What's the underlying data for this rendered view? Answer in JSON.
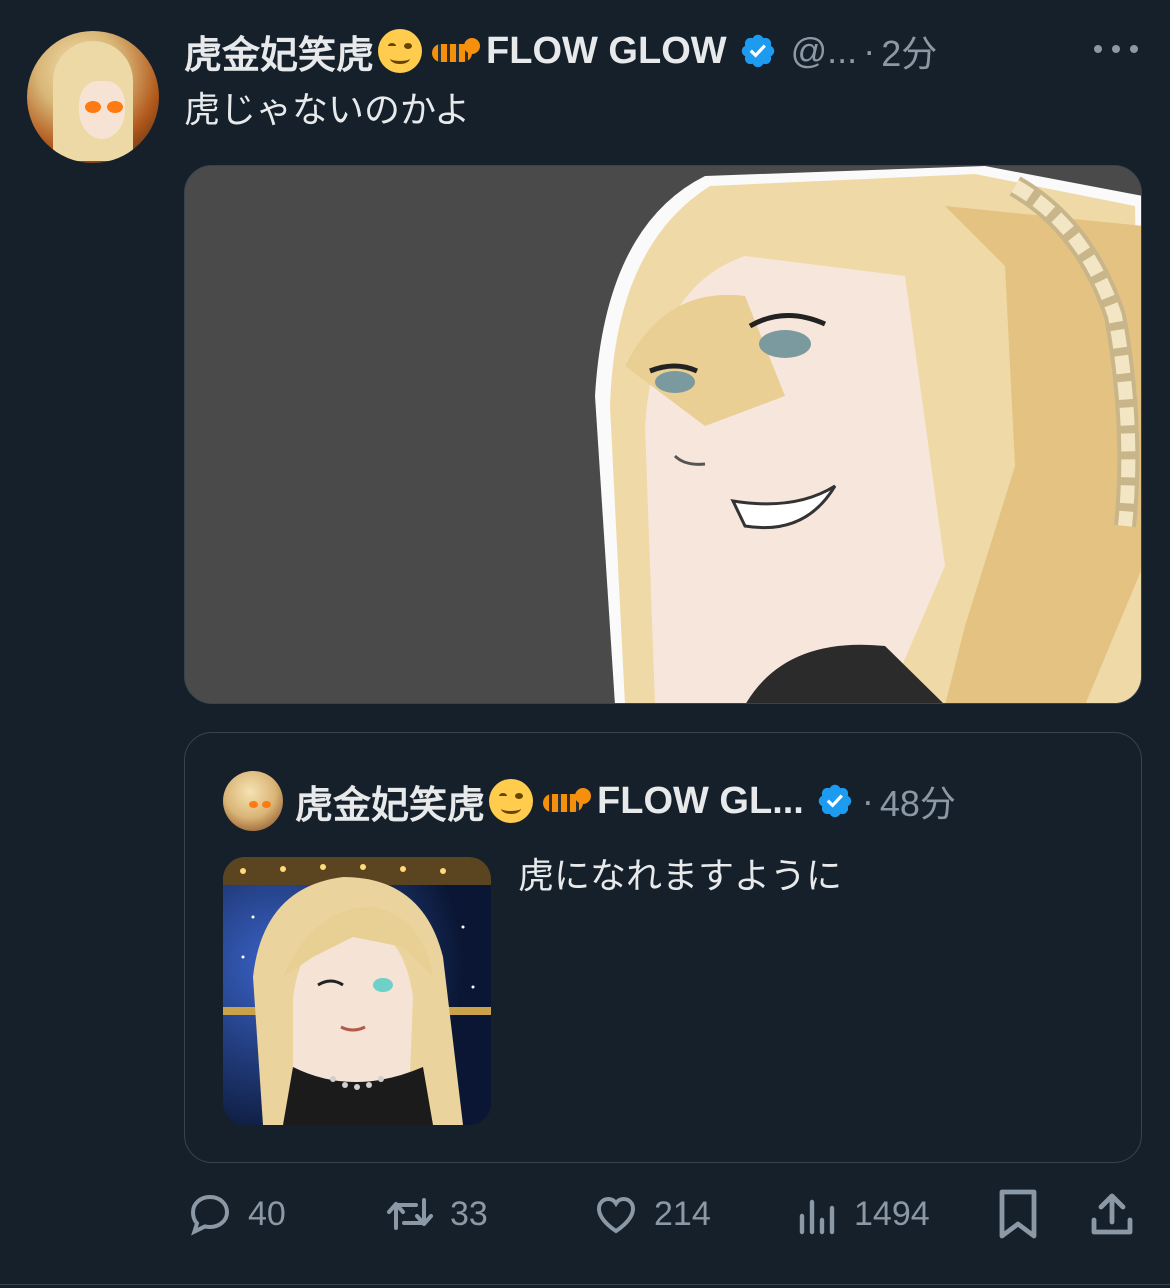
{
  "tweet": {
    "display_name": "虎金妃笑虎",
    "display_name_suffix": "FLOW GLOW",
    "handle": "@...",
    "separator": "·",
    "time": "2分",
    "text": "虎じゃないのかよ"
  },
  "quote": {
    "display_name": "虎金妃笑虎",
    "display_name_suffix": "FLOW GL...",
    "separator": "·",
    "time": "48分",
    "text": "虎になれますように"
  },
  "actions": {
    "replies": "40",
    "reposts": "33",
    "likes": "214",
    "views": "1494"
  },
  "icons": [
    "more-icon",
    "verified-icon",
    "reply-icon",
    "repost-icon",
    "like-icon",
    "views-icon",
    "bookmark-icon",
    "share-icon"
  ],
  "colors": {
    "background": "#15202b",
    "text": "#e7e9ea",
    "secondary": "#8b98a5",
    "verified": "#1d9bf0",
    "border": "#38444d"
  }
}
